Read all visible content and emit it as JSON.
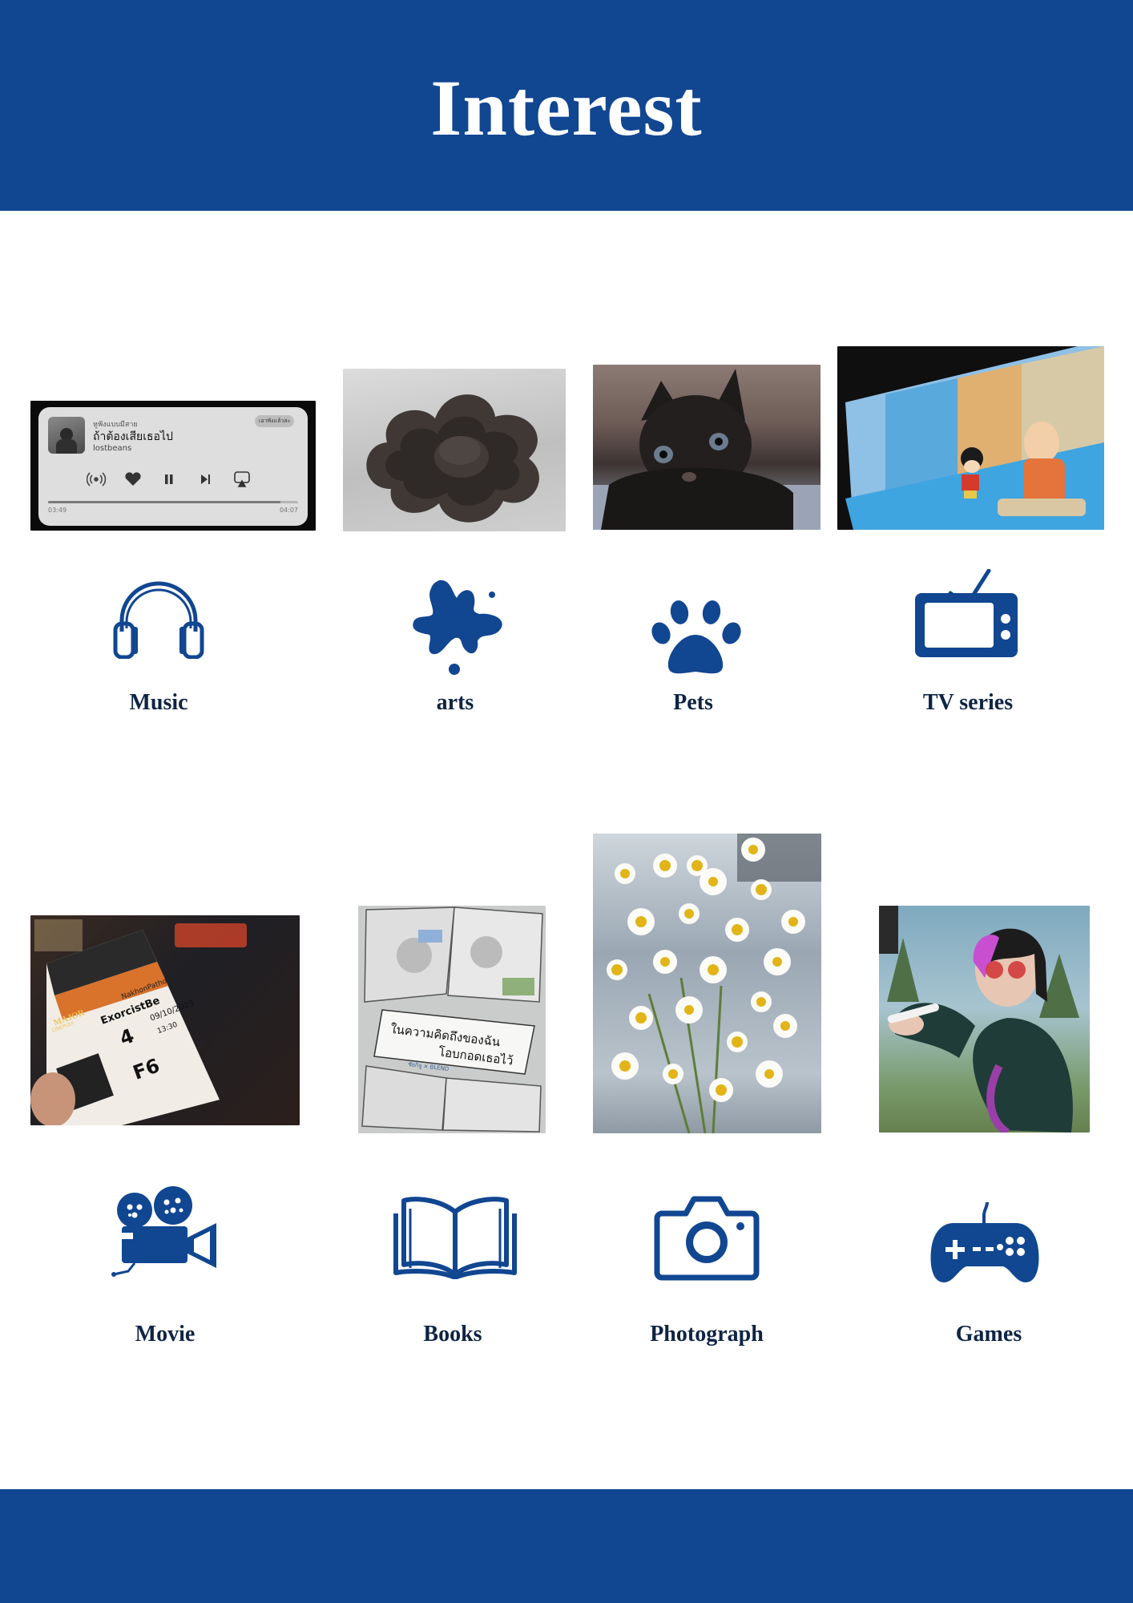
{
  "title": "Interest",
  "colors": {
    "brand": "#114691",
    "label": "#0f2444",
    "background": "#ffffff"
  },
  "music_card": {
    "status": "หูฟังแบบมีสาย",
    "song": "ถ้าต้องเสียเธอไป",
    "artist": "lostbeans",
    "badge": "เอาพังแล้วล่ะ",
    "elapsed": "03:49",
    "duration": "04:07",
    "progress": 0.93
  },
  "ticket": {
    "brand": "MAJOR",
    "sub": "CINEPLEX",
    "branch": "NakhonPathom",
    "movie": "ExorcistBe",
    "date": "09/10/2023",
    "time": "13:30",
    "hall": "4",
    "seat": "F6"
  },
  "book_cover": {
    "line1": "ในความคิดถึงของฉัน",
    "line2": "โอบกอดเธอไว้",
    "author": "ชัยกิจู × BLEND"
  },
  "interests": [
    {
      "label": "Music",
      "icon": "headphones-icon"
    },
    {
      "label": "arts",
      "icon": "paint-splash-icon"
    },
    {
      "label": "Pets",
      "icon": "paw-icon"
    },
    {
      "label": "TV series",
      "icon": "tv-icon"
    },
    {
      "label": "Movie",
      "icon": "movie-camera-icon"
    },
    {
      "label": "Books",
      "icon": "open-book-icon"
    },
    {
      "label": "Photograph",
      "icon": "camera-icon"
    },
    {
      "label": "Games",
      "icon": "gamepad-icon"
    }
  ]
}
